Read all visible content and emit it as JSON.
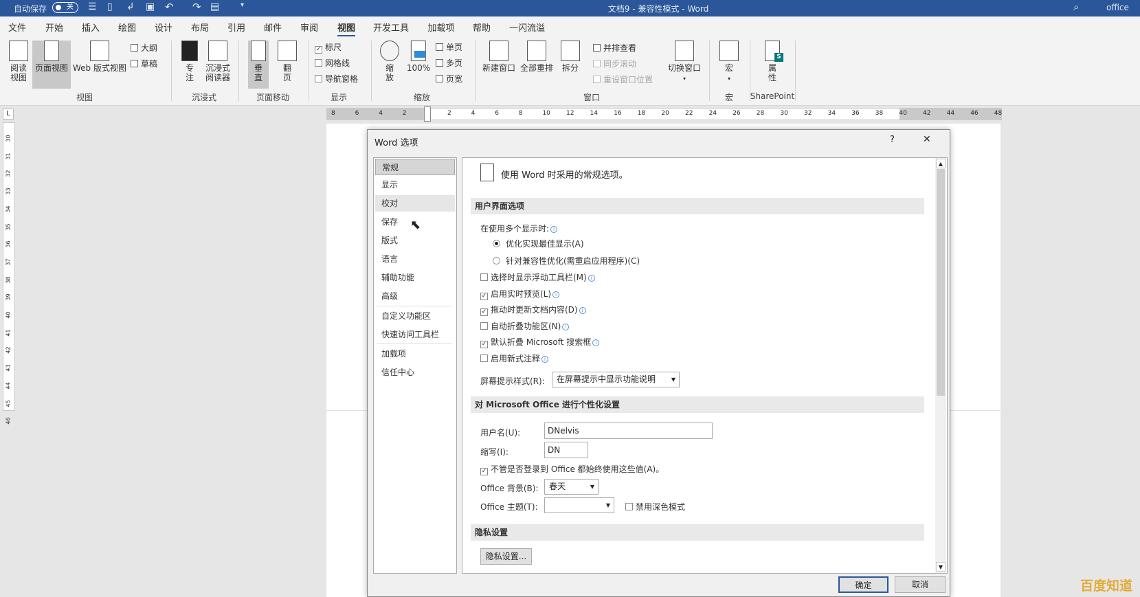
{
  "titlebar": {
    "autosave_label": "自动保存",
    "autosave_state": "关",
    "title": "文档9 - 兼容性模式 - Word",
    "account": "office",
    "accent": "#2b579a"
  },
  "tabs": [
    "文件",
    "开始",
    "插入",
    "绘图",
    "设计",
    "布局",
    "引用",
    "邮件",
    "审阅",
    "视图",
    "开发工具",
    "加载项",
    "帮助",
    "一闪流溢"
  ],
  "active_tab": "视图",
  "ribbon": {
    "view": {
      "read": "阅读\n视图",
      "print": "页面视图",
      "web": "Web 版式视图",
      "outline": "大纲",
      "draft": "草稿",
      "label": "视图"
    },
    "immersive": {
      "focus": "专\n注",
      "reader": "沉浸式\n阅读器",
      "label": "沉浸式"
    },
    "page_move": {
      "vertical": "垂\n直",
      "side": "翻\n页",
      "label": "页面移动"
    },
    "show": {
      "ruler": "标尺",
      "ruler_checked": true,
      "gridlines": "网格线",
      "gridlines_checked": false,
      "nav": "导航窗格",
      "nav_checked": false,
      "label": "显示"
    },
    "zoom": {
      "zoom": "缩\n放",
      "hundred": "100%",
      "one": "单页",
      "multi": "多页",
      "width": "页宽",
      "label": "缩放"
    },
    "window": {
      "new": "新建窗口",
      "arrange": "全部重排",
      "split": "拆分",
      "side": "并排查看",
      "sync": "同步滚动",
      "reset": "重设窗口位置",
      "switch": "切换窗口",
      "label": "窗口"
    },
    "macros": {
      "macro": "宏",
      "label": "宏"
    },
    "sharepoint": {
      "props": "属\n性",
      "label": "SharePoint"
    }
  },
  "ruler": {
    "h_left": [
      "8",
      "6",
      "4",
      "2"
    ],
    "h_right": [
      "2",
      "4",
      "6",
      "8",
      "10",
      "12",
      "14",
      "16",
      "18",
      "20",
      "22",
      "24",
      "26",
      "28",
      "30",
      "32",
      "34",
      "36",
      "38",
      "40",
      "42",
      "44",
      "46",
      "48"
    ],
    "v": [
      "30",
      "31",
      "32",
      "33",
      "34",
      "35",
      "36",
      "37",
      "38",
      "39",
      "40",
      "41",
      "42",
      "43",
      "44",
      "45",
      "46"
    ]
  },
  "dialog": {
    "title": "Word 选项",
    "help": "?",
    "close": "✕",
    "nav": [
      "常规",
      "显示",
      "校对",
      "保存",
      "版式",
      "语言",
      "辅助功能",
      "高级",
      "自定义功能区",
      "快速访问工具栏",
      "加载项",
      "信任中心"
    ],
    "nav_selected": "常规",
    "header": "使用 Word 时采用的常规选项。",
    "sections": {
      "ui": {
        "title": "用户界面选项",
        "multi_display": "在使用多个显示时:",
        "radio_best": "优化实现最佳显示(A)",
        "radio_best_on": true,
        "radio_compat": "针对兼容性优化(需重启应用程序)(C)",
        "checks": [
          {
            "label": "选择时显示浮动工具栏(M)",
            "checked": false
          },
          {
            "label": "启用实时预览(L)",
            "checked": true
          },
          {
            "label": "拖动时更新文档内容(D)",
            "checked": true
          },
          {
            "label": "自动折叠功能区(N)",
            "checked": false
          },
          {
            "label": "默认折叠 Microsoft 搜索框",
            "checked": true
          },
          {
            "label": "启用新式注释",
            "checked": false
          }
        ],
        "tip_label": "屏幕提示样式(R):",
        "tip_value": "在屏幕提示中显示功能说明"
      },
      "personal": {
        "title": "对 Microsoft Office 进行个性化设置",
        "username_label": "用户名(U):",
        "username": "DNelvis",
        "initials_label": "缩写(I):",
        "initials": "DN",
        "always_use": "不管是否登录到 Office 都始终使用这些值(A)。",
        "always_use_checked": true,
        "bg_label": "Office 背景(B):",
        "bg_value": "春天",
        "theme_label": "Office 主题(T):",
        "theme_value": "",
        "dark_label": "禁用深色模式",
        "dark_checked": false
      },
      "privacy": {
        "title": "隐私设置",
        "button": "隐私设置..."
      }
    },
    "ok": "确定",
    "cancel": "取消"
  },
  "watermark": "百度知道"
}
